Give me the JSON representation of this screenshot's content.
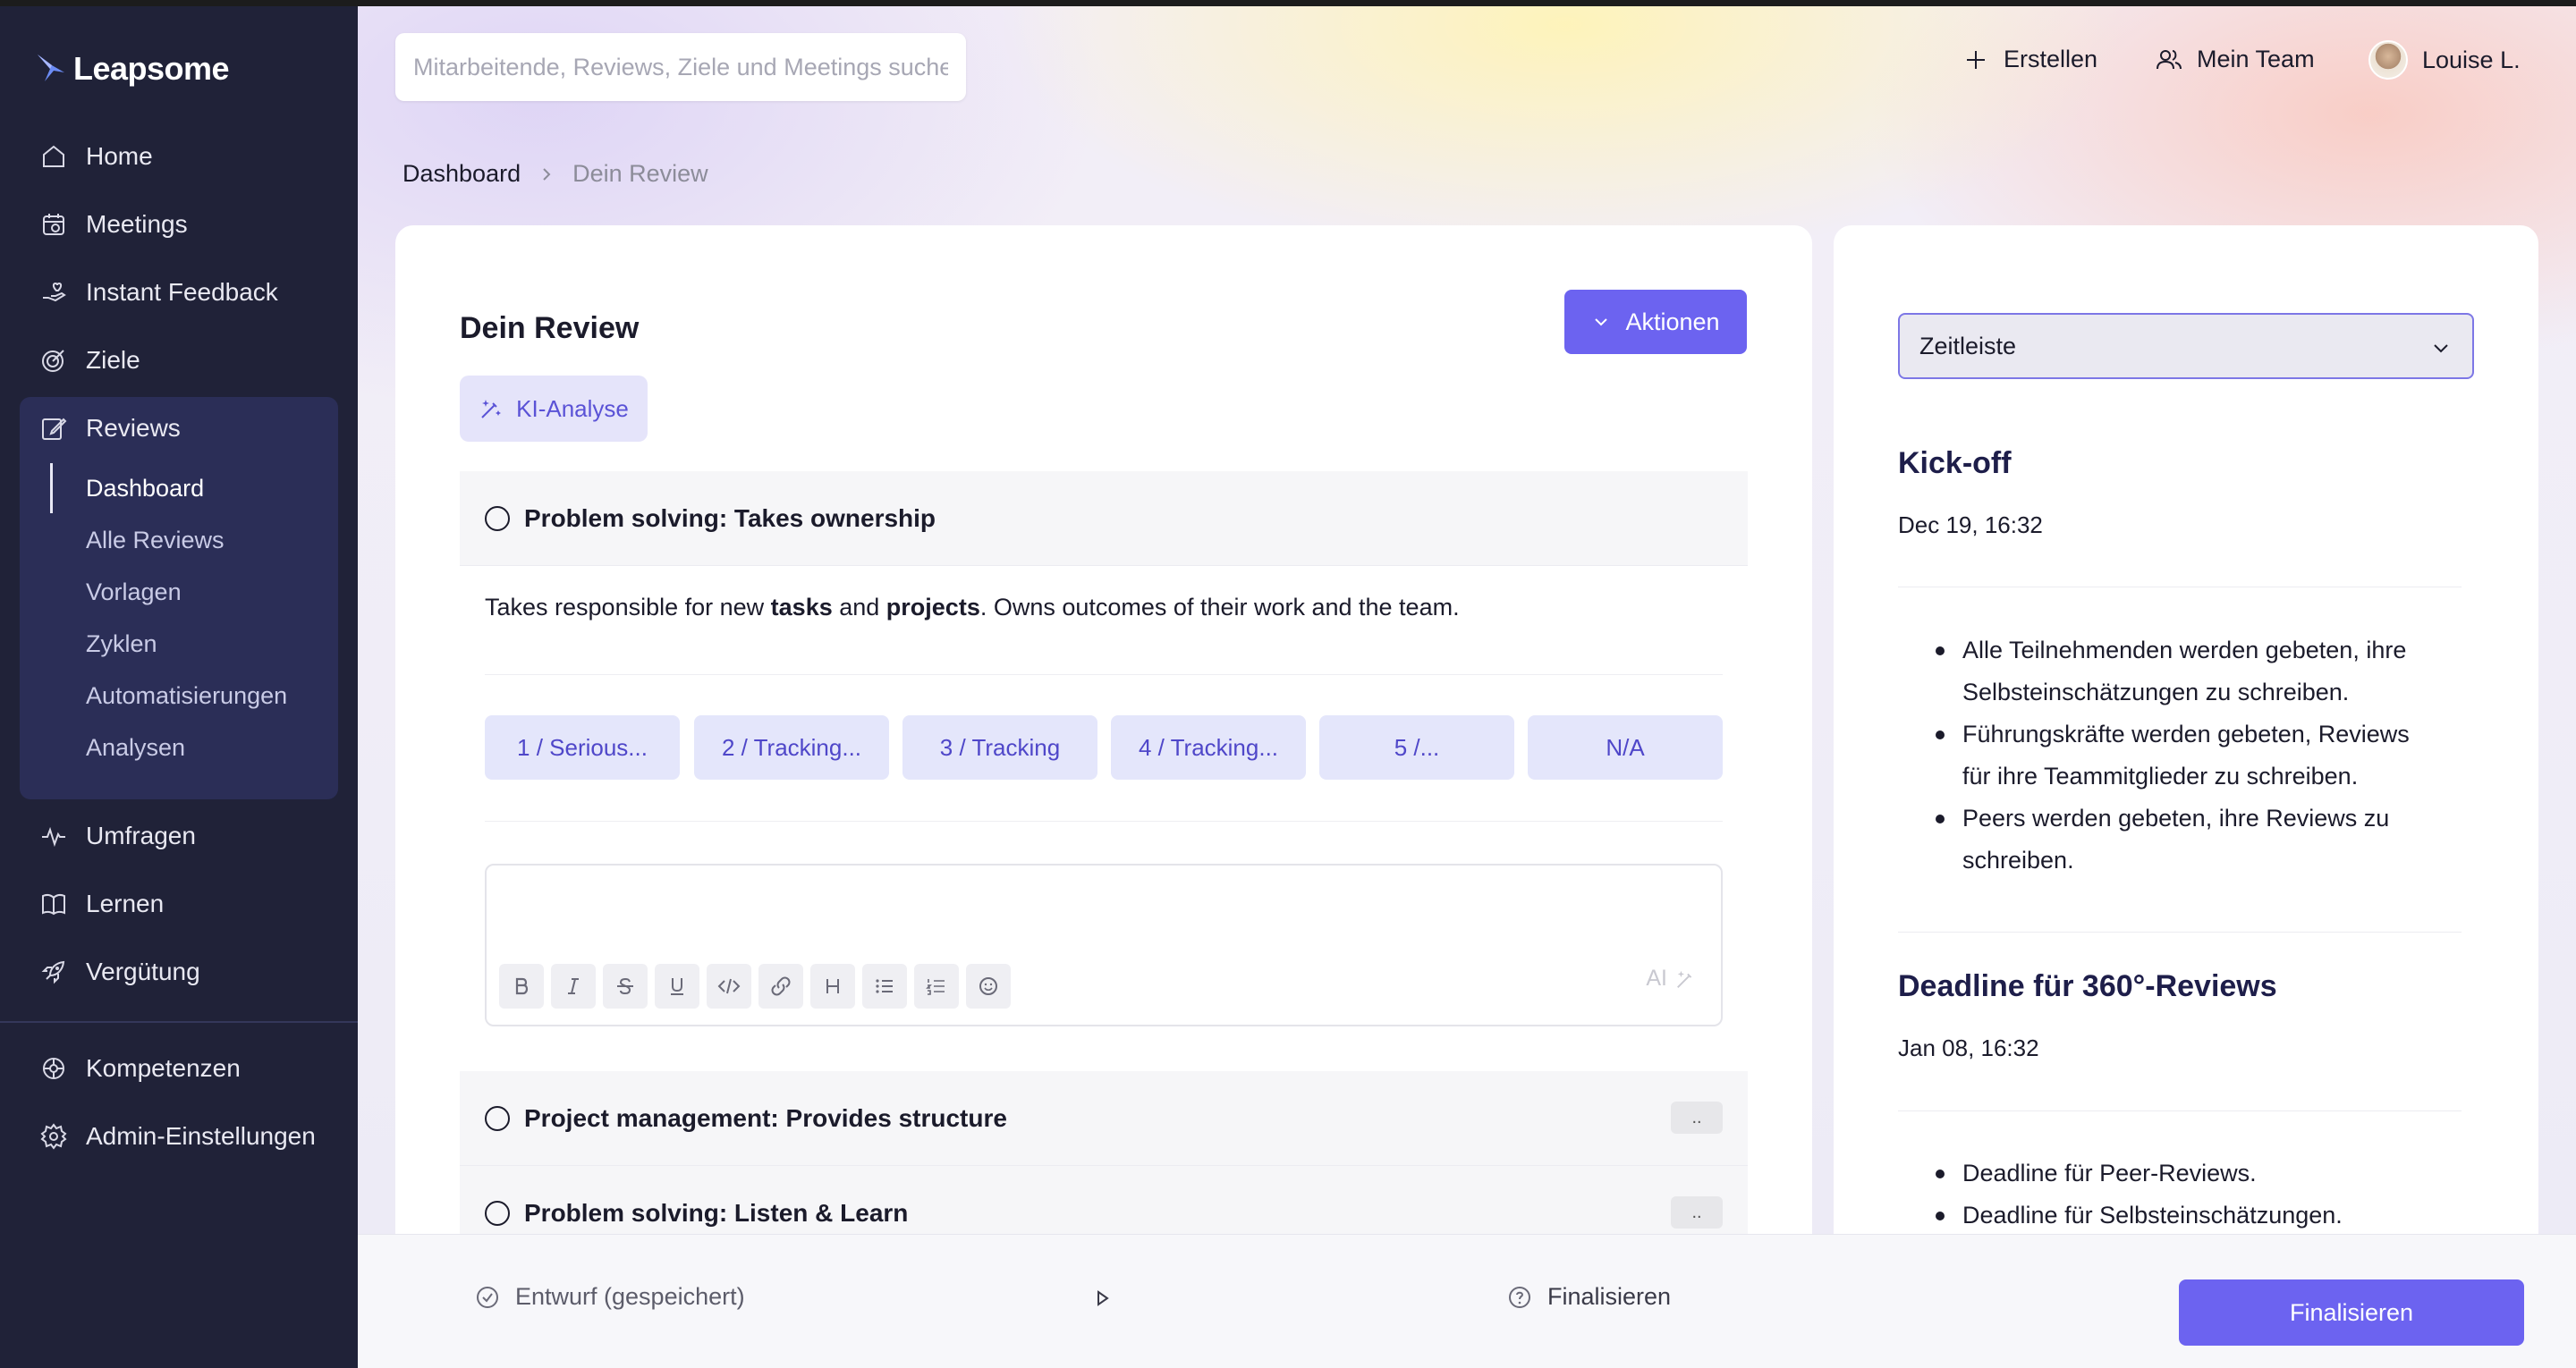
{
  "app": {
    "brand": "Leapsome"
  },
  "sidebar": {
    "items": [
      {
        "label": "Home",
        "icon": "home-icon"
      },
      {
        "label": "Meetings",
        "icon": "calendar-icon"
      },
      {
        "label": "Instant Feedback",
        "icon": "hand-heart-icon"
      },
      {
        "label": "Ziele",
        "icon": "target-icon"
      },
      {
        "label": "Reviews",
        "icon": "edit-icon"
      },
      {
        "label": "Umfragen",
        "icon": "pulse-icon"
      },
      {
        "label": "Lernen",
        "icon": "book-icon"
      },
      {
        "label": "Vergütung",
        "icon": "rocket-icon"
      },
      {
        "label": "Kompetenzen",
        "icon": "network-icon"
      },
      {
        "label": "Admin-Einstellungen",
        "icon": "gear-icon"
      }
    ],
    "reviews_sub": [
      "Dashboard",
      "Alle Reviews",
      "Vorlagen",
      "Zyklen",
      "Automatisierungen",
      "Analysen"
    ],
    "active_sub": "Dashboard"
  },
  "header": {
    "search_placeholder": "Mitarbeitende, Reviews, Ziele und Meetings suchen",
    "create_label": "Erstellen",
    "team_label": "Mein Team",
    "user_name": "Louise L."
  },
  "breadcrumb": {
    "parent": "Dashboard",
    "current": "Dein Review"
  },
  "review": {
    "title": "Dein Review",
    "actions_label": "Aktionen",
    "ai_label": "KI-Analyse",
    "questions": [
      {
        "title": "Problem solving: Takes ownership",
        "badge": ""
      },
      {
        "title": "Project management: Provides structure",
        "badge": ".."
      },
      {
        "title": "Problem solving: Listen & Learn",
        "badge": ".."
      }
    ],
    "description": {
      "part1": "Takes responsible for new ",
      "bold1": "tasks",
      "part2": " and ",
      "bold2": "projects",
      "part3": ". Owns outcomes of their work and the team."
    },
    "ratings": [
      "1 / Serious...",
      "2 / Tracking...",
      "3 / Tracking",
      "4 / Tracking...",
      "5 /...",
      "N/A"
    ],
    "editor_ai_hint": "AI"
  },
  "timeline": {
    "select_label": "Zeitleiste",
    "events": [
      {
        "title": "Kick-off",
        "date": "Dec 19, 16:32",
        "bullets": [
          "Alle Teilnehmenden werden gebeten, ihre Selbsteinschätzungen zu schreiben.",
          "Führungskräfte werden gebeten, Reviews für ihre Teammitglieder zu schreiben.",
          "Peers werden gebeten, ihre Reviews zu schreiben."
        ]
      },
      {
        "title": "Deadline für 360°-Reviews",
        "date": "Jan 08, 16:32",
        "bullets": [
          "Deadline für Peer-Reviews.",
          "Deadline für Selbsteinschätzungen."
        ]
      }
    ]
  },
  "footer": {
    "status": "Entwurf (gespeichert)",
    "next_step": "Finalisieren",
    "finalize_button": "Finalisieren"
  },
  "colors": {
    "accent": "#6c63f0",
    "sidebar": "#202238",
    "sidebar_active": "#2b2e57"
  }
}
